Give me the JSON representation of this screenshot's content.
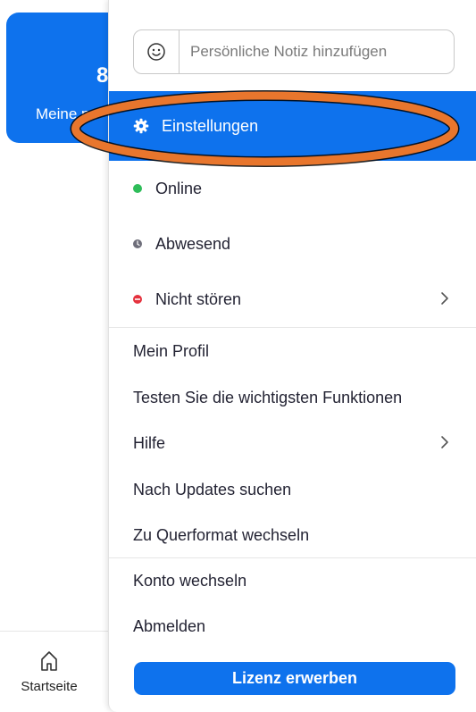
{
  "background": {
    "card_number": "8",
    "card_label": "Meine pe",
    "home_label": "Startseite"
  },
  "menu": {
    "note_placeholder": "Persönliche Notiz hinzufügen",
    "settings_label": "Einstellungen",
    "status_items": [
      {
        "label": "Online",
        "color": "#2ebd59"
      },
      {
        "label": "Abwesend",
        "color": "#6e6e7a"
      },
      {
        "label": "Nicht stören",
        "color": "#e5323e"
      }
    ],
    "items": [
      {
        "label": "Mein Profil"
      },
      {
        "label": "Testen Sie die wichtigsten Funktionen"
      },
      {
        "label": "Hilfe"
      },
      {
        "label": "Nach Updates suchen"
      },
      {
        "label": "Zu Querformat wechseln"
      },
      {
        "label": "Konto wechseln"
      },
      {
        "label": "Abmelden"
      }
    ],
    "buy_button_label": "Lizenz erwerben"
  },
  "colors": {
    "accent": "#0e72ed",
    "annotation": "#e8762d"
  }
}
